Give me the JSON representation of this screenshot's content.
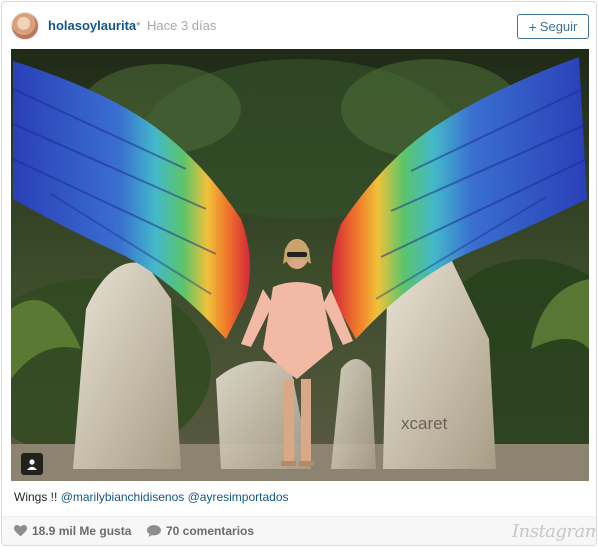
{
  "header": {
    "username": "holasoylaurita",
    "separator": "•",
    "timestamp": "Hace 3 días",
    "follow_label": "Seguir",
    "follow_plus": "+"
  },
  "photo": {
    "sign_text": "xcaret"
  },
  "caption": {
    "text": "Wings !! ",
    "mention_1": "@marilybianchidisenos",
    "mention_2": "@ayresimportados"
  },
  "footer": {
    "likes": "18.9 mil Me gusta",
    "comments": "70 comentarios",
    "brand": "Instagram"
  },
  "icons": {
    "heart": "heart-icon",
    "comment": "comment-icon",
    "user_tag": "user-tag-icon"
  },
  "colors": {
    "link": "#125688",
    "follow": "#3f729b",
    "meta": "#a5a7aa"
  }
}
